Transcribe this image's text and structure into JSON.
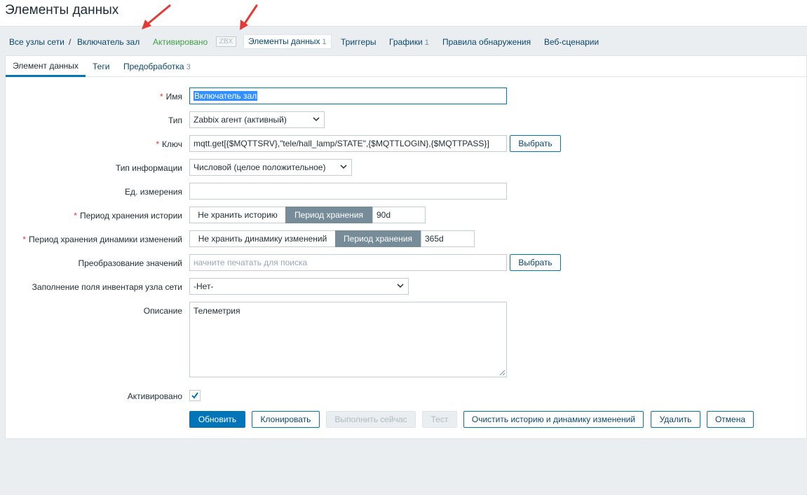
{
  "page": {
    "title": "Элементы данных"
  },
  "nav": {
    "all_hosts": "Все узлы сети",
    "separator": "/",
    "host": "Включатель зал",
    "status": "Активировано",
    "zbx": "ZBX",
    "items": {
      "label": "Элементы данных",
      "count": "1"
    },
    "triggers": "Триггеры",
    "graphs": {
      "label": "Графики",
      "count": "1"
    },
    "discovery": "Правила обнаружения",
    "web": "Веб-сценарии"
  },
  "tabs": {
    "item": "Элемент данных",
    "tags": "Теги",
    "preprocessing": {
      "label": "Предобработка",
      "count": "3"
    }
  },
  "form": {
    "required_mark": "*",
    "name": {
      "label": "Имя",
      "value": "Включатель зал"
    },
    "type": {
      "label": "Тип",
      "value": "Zabbix агент (активный)"
    },
    "key": {
      "label": "Ключ",
      "value": "mqtt.get[{$MQTTSRV},\"tele/hall_lamp/STATE\",{$MQTTLOGIN},{$MQTTPASS}]",
      "button": "Выбрать"
    },
    "info_type": {
      "label": "Тип информации",
      "value": "Числовой (целое положительное)"
    },
    "units": {
      "label": "Ед. измерения",
      "value": ""
    },
    "history": {
      "label": "Период хранения истории",
      "opt_off": "Не хранить историю",
      "opt_on": "Период хранения",
      "value": "90d"
    },
    "trends": {
      "label": "Период хранения динамики изменений",
      "opt_off": "Не хранить динамику изменений",
      "opt_on": "Период хранения",
      "value": "365d"
    },
    "valuemap": {
      "label": "Преобразование значений",
      "placeholder": "начните печатать для поиска",
      "button": "Выбрать"
    },
    "inventory": {
      "label": "Заполнение поля инвентаря узла сети",
      "value": "-Нет-"
    },
    "description": {
      "label": "Описание",
      "value": "Телеметрия"
    },
    "enabled": {
      "label": "Активировано",
      "checked": true
    }
  },
  "buttons": {
    "update": "Обновить",
    "clone": "Клонировать",
    "execute": "Выполнить сейчас",
    "test": "Тест",
    "clear": "Очистить историю и динамику изменений",
    "delete": "Удалить",
    "cancel": "Отмена"
  },
  "colors": {
    "link": "#0a466a",
    "accent": "#0275b8",
    "enabled": "#429e47",
    "required": "#e33734",
    "annotation_arrow": "#e53935"
  }
}
